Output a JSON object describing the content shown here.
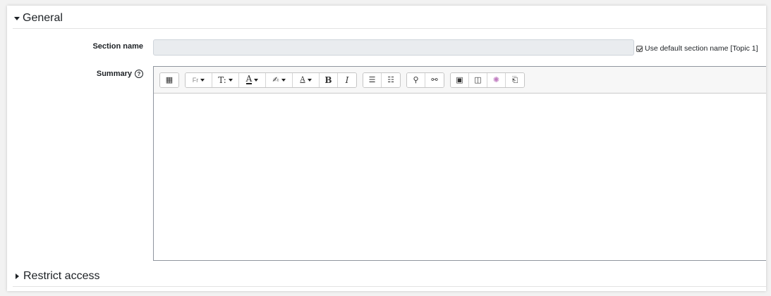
{
  "sections": {
    "general": {
      "title": "General"
    },
    "restrict": {
      "title": "Restrict access"
    }
  },
  "form": {
    "section_name": {
      "label": "Section name",
      "value": "",
      "default_checkbox_label": "Use default section name [Topic 1]",
      "default_checked": true
    },
    "summary": {
      "label": "Summary",
      "help_icon": "question-circle-icon",
      "content": ""
    }
  },
  "editor_toolbar": {
    "groups": [
      [
        {
          "name": "show-more-buttons",
          "glyph": "▦"
        }
      ],
      [
        {
          "name": "font-family",
          "glyph": "Fr",
          "dropdown": true
        },
        {
          "name": "font-size",
          "glyph": "T:",
          "dropdown": true
        },
        {
          "name": "font-color",
          "glyph": "A",
          "dropdown": true
        },
        {
          "name": "background-color",
          "glyph": "✍",
          "dropdown": true
        },
        {
          "name": "text-style",
          "glyph": "A",
          "dropdown": true
        },
        {
          "name": "bold",
          "glyph": "B"
        },
        {
          "name": "italic",
          "glyph": "I"
        }
      ],
      [
        {
          "name": "unordered-list",
          "glyph": "☰"
        },
        {
          "name": "ordered-list",
          "glyph": "☷"
        }
      ],
      [
        {
          "name": "link",
          "glyph": "⚲"
        },
        {
          "name": "unlink",
          "glyph": "⚯"
        }
      ],
      [
        {
          "name": "image",
          "glyph": "▣"
        },
        {
          "name": "media",
          "glyph": "◫"
        },
        {
          "name": "h5p",
          "glyph": "✺"
        },
        {
          "name": "manage-files",
          "glyph": "⎗"
        }
      ]
    ]
  }
}
